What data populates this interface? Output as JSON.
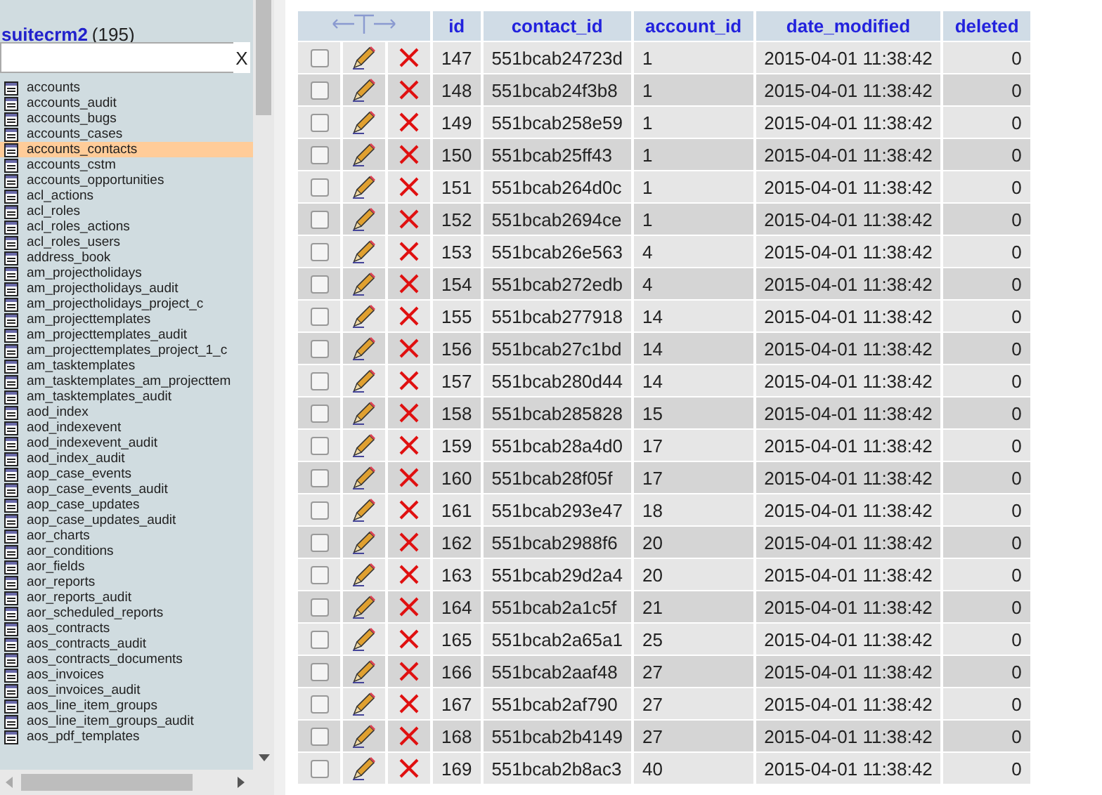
{
  "sidebar": {
    "database": "suitecrm2",
    "count": "(195)",
    "filter": {
      "clear": "X"
    },
    "tables": [
      {
        "name": "accounts",
        "selected": false
      },
      {
        "name": "accounts_audit",
        "selected": false
      },
      {
        "name": "accounts_bugs",
        "selected": false
      },
      {
        "name": "accounts_cases",
        "selected": false
      },
      {
        "name": "accounts_contacts",
        "selected": true
      },
      {
        "name": "accounts_cstm",
        "selected": false
      },
      {
        "name": "accounts_opportunities",
        "selected": false
      },
      {
        "name": "acl_actions",
        "selected": false
      },
      {
        "name": "acl_roles",
        "selected": false
      },
      {
        "name": "acl_roles_actions",
        "selected": false
      },
      {
        "name": "acl_roles_users",
        "selected": false
      },
      {
        "name": "address_book",
        "selected": false
      },
      {
        "name": "am_projectholidays",
        "selected": false
      },
      {
        "name": "am_projectholidays_audit",
        "selected": false
      },
      {
        "name": "am_projectholidays_project_c",
        "selected": false
      },
      {
        "name": "am_projecttemplates",
        "selected": false
      },
      {
        "name": "am_projecttemplates_audit",
        "selected": false
      },
      {
        "name": "am_projecttemplates_project_1_c",
        "selected": false
      },
      {
        "name": "am_tasktemplates",
        "selected": false
      },
      {
        "name": "am_tasktemplates_am_projecttem",
        "selected": false
      },
      {
        "name": "am_tasktemplates_audit",
        "selected": false
      },
      {
        "name": "aod_index",
        "selected": false
      },
      {
        "name": "aod_indexevent",
        "selected": false
      },
      {
        "name": "aod_indexevent_audit",
        "selected": false
      },
      {
        "name": "aod_index_audit",
        "selected": false
      },
      {
        "name": "aop_case_events",
        "selected": false
      },
      {
        "name": "aop_case_events_audit",
        "selected": false
      },
      {
        "name": "aop_case_updates",
        "selected": false
      },
      {
        "name": "aop_case_updates_audit",
        "selected": false
      },
      {
        "name": "aor_charts",
        "selected": false
      },
      {
        "name": "aor_conditions",
        "selected": false
      },
      {
        "name": "aor_fields",
        "selected": false
      },
      {
        "name": "aor_reports",
        "selected": false
      },
      {
        "name": "aor_reports_audit",
        "selected": false
      },
      {
        "name": "aor_scheduled_reports",
        "selected": false
      },
      {
        "name": "aos_contracts",
        "selected": false
      },
      {
        "name": "aos_contracts_audit",
        "selected": false
      },
      {
        "name": "aos_contracts_documents",
        "selected": false
      },
      {
        "name": "aos_invoices",
        "selected": false
      },
      {
        "name": "aos_invoices_audit",
        "selected": false
      },
      {
        "name": "aos_line_item_groups",
        "selected": false
      },
      {
        "name": "aos_line_item_groups_audit",
        "selected": false
      },
      {
        "name": "aos_pdf_templates",
        "selected": false
      }
    ]
  },
  "table": {
    "columns": [
      "id",
      "contact_id",
      "account_id",
      "date_modified",
      "deleted"
    ],
    "rows": [
      {
        "checked": false,
        "cells": [
          "147",
          "551bcab24723d",
          "1",
          "2015-04-01 11:38:42",
          "0"
        ]
      },
      {
        "checked": false,
        "cells": [
          "148",
          "551bcab24f3b8",
          "1",
          "2015-04-01 11:38:42",
          "0"
        ]
      },
      {
        "checked": false,
        "cells": [
          "149",
          "551bcab258e59",
          "1",
          "2015-04-01 11:38:42",
          "0"
        ]
      },
      {
        "checked": false,
        "cells": [
          "150",
          "551bcab25ff43",
          "1",
          "2015-04-01 11:38:42",
          "0"
        ]
      },
      {
        "checked": false,
        "cells": [
          "151",
          "551bcab264d0c",
          "1",
          "2015-04-01 11:38:42",
          "0"
        ]
      },
      {
        "checked": false,
        "cells": [
          "152",
          "551bcab2694ce",
          "1",
          "2015-04-01 11:38:42",
          "0"
        ]
      },
      {
        "checked": false,
        "cells": [
          "153",
          "551bcab26e563",
          "4",
          "2015-04-01 11:38:42",
          "0"
        ]
      },
      {
        "checked": false,
        "cells": [
          "154",
          "551bcab272edb",
          "4",
          "2015-04-01 11:38:42",
          "0"
        ]
      },
      {
        "checked": false,
        "cells": [
          "155",
          "551bcab277918",
          "14",
          "2015-04-01 11:38:42",
          "0"
        ]
      },
      {
        "checked": false,
        "cells": [
          "156",
          "551bcab27c1bd",
          "14",
          "2015-04-01 11:38:42",
          "0"
        ]
      },
      {
        "checked": false,
        "cells": [
          "157",
          "551bcab280d44",
          "14",
          "2015-04-01 11:38:42",
          "0"
        ]
      },
      {
        "checked": false,
        "cells": [
          "158",
          "551bcab285828",
          "15",
          "2015-04-01 11:38:42",
          "0"
        ]
      },
      {
        "checked": false,
        "cells": [
          "159",
          "551bcab28a4d0",
          "17",
          "2015-04-01 11:38:42",
          "0"
        ]
      },
      {
        "checked": false,
        "cells": [
          "160",
          "551bcab28f05f",
          "17",
          "2015-04-01 11:38:42",
          "0"
        ]
      },
      {
        "checked": false,
        "cells": [
          "161",
          "551bcab293e47",
          "18",
          "2015-04-01 11:38:42",
          "0"
        ]
      },
      {
        "checked": false,
        "cells": [
          "162",
          "551bcab2988f6",
          "20",
          "2015-04-01 11:38:42",
          "0"
        ]
      },
      {
        "checked": false,
        "cells": [
          "163",
          "551bcab29d2a4",
          "20",
          "2015-04-01 11:38:42",
          "0"
        ]
      },
      {
        "checked": false,
        "cells": [
          "164",
          "551bcab2a1c5f",
          "21",
          "2015-04-01 11:38:42",
          "0"
        ]
      },
      {
        "checked": false,
        "cells": [
          "165",
          "551bcab2a65a1",
          "25",
          "2015-04-01 11:38:42",
          "0"
        ]
      },
      {
        "checked": false,
        "cells": [
          "166",
          "551bcab2aaf48",
          "27",
          "2015-04-01 11:38:42",
          "0"
        ]
      },
      {
        "checked": false,
        "cells": [
          "167",
          "551bcab2af790",
          "27",
          "2015-04-01 11:38:42",
          "0"
        ]
      },
      {
        "checked": false,
        "cells": [
          "168",
          "551bcab2b4149",
          "27",
          "2015-04-01 11:38:42",
          "0"
        ]
      },
      {
        "checked": false,
        "cells": [
          "169",
          "551bcab2b8ac3",
          "40",
          "2015-04-01 11:38:42",
          "0"
        ]
      }
    ]
  }
}
